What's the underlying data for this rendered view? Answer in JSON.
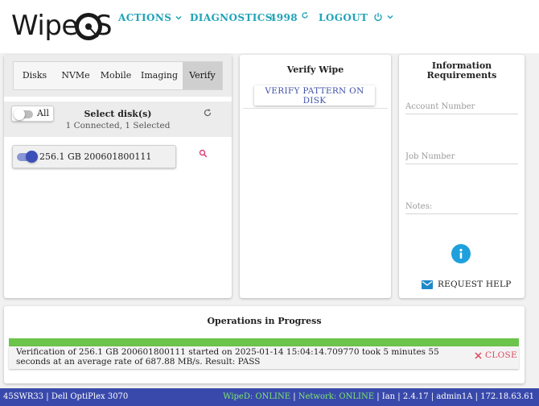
{
  "brand": {
    "logo_text": "Wipe",
    "logo_suffix": "S"
  },
  "nav": {
    "actions": "ACTIONS",
    "diagnostics": "DIAGNOSTICS",
    "count": "4998",
    "logout": "LOGOUT"
  },
  "disk_panel": {
    "tabs": [
      "Disks",
      "NVMe",
      "Mobile",
      "Imaging",
      "Verify"
    ],
    "active_tab": "Verify",
    "toggle_all_label": "All",
    "title": "Select disk(s)",
    "subtitle": "1 Connected, 1 Selected",
    "disks": [
      {
        "label": "256.1 GB 200601800111",
        "selected": true
      }
    ]
  },
  "verify_panel": {
    "title": "Verify Wipe",
    "button": "VERIFY PATTERN ON DISK"
  },
  "info_panel": {
    "title_line1": "Information",
    "title_line2": "Requirements",
    "account_placeholder": "Account Number",
    "job_placeholder": "Job Number",
    "notes_placeholder": "Notes:",
    "help": "REQUEST HELP"
  },
  "operations": {
    "title": "Operations in Progress",
    "progress": 1.0,
    "message": "Verification of 256.1 GB 200601800111 started on 2025-01-14 15:04:14.709770 took 5 minutes 55 seconds at an average rate of 687.88 MB/s. Result: PASS",
    "close": "CLOSE"
  },
  "footer": {
    "asset": "45SWR33",
    "model": "Dell OptiPlex 3070",
    "wiped_label": "WipeD:",
    "wiped_status": "ONLINE",
    "network_label": "Network:",
    "network_status": "ONLINE",
    "user": "Ian",
    "version": "2.4.17",
    "account": "admin1A",
    "ip": "172.18.63.61"
  },
  "colors": {
    "nav_accent": "#1fa3b8",
    "footer_bg": "#3949ab",
    "online": "#7ee76a",
    "progress": "#6cc44a",
    "close": "#e0455a",
    "button_text": "#3f51a8",
    "info_icon": "#1ea0dd"
  },
  "icons": [
    "chevron-down-icon",
    "refresh-icon",
    "power-icon",
    "search-icon",
    "info-icon",
    "mail-icon",
    "close-icon",
    "disk-icon"
  ]
}
